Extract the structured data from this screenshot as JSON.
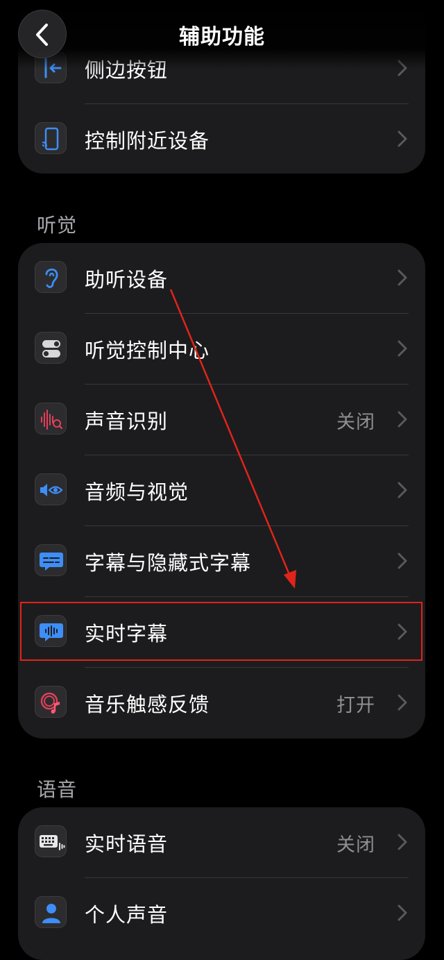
{
  "nav": {
    "title": "辅助功能",
    "back_icon": "chevron-left-icon"
  },
  "colors": {
    "background": "#000000",
    "card": "#1c1c1e",
    "accent_blue": "#3d8ef7",
    "annotation_red": "#e0241b",
    "secondary_text": "#8e8e93"
  },
  "top_group": {
    "rows": [
      {
        "label": "侧边按钮",
        "value": "",
        "icon": "side-button-icon"
      },
      {
        "label": "控制附近设备",
        "value": "",
        "icon": "control-nearby-devices-icon"
      }
    ]
  },
  "hearing": {
    "header": "听觉",
    "rows": [
      {
        "label": "助听设备",
        "value": "",
        "icon": "ear-icon"
      },
      {
        "label": "听觉控制中心",
        "value": "",
        "icon": "toggles-icon"
      },
      {
        "label": "声音识别",
        "value": "关闭",
        "icon": "sound-waveform-icon"
      },
      {
        "label": "音频与视觉",
        "value": "",
        "icon": "speaker-eye-icon"
      },
      {
        "label": "字幕与隐藏式字幕",
        "value": "",
        "icon": "captions-bubble-icon"
      },
      {
        "label": "实时字幕",
        "value": "",
        "icon": "live-captions-icon"
      },
      {
        "label": "音乐触感反馈",
        "value": "打开",
        "icon": "music-haptics-icon"
      }
    ]
  },
  "speech": {
    "header": "语音",
    "rows": [
      {
        "label": "实时语音",
        "value": "关闭",
        "icon": "keyboard-waveform-icon"
      },
      {
        "label": "个人声音",
        "value": "",
        "icon": "person-icon"
      }
    ]
  }
}
